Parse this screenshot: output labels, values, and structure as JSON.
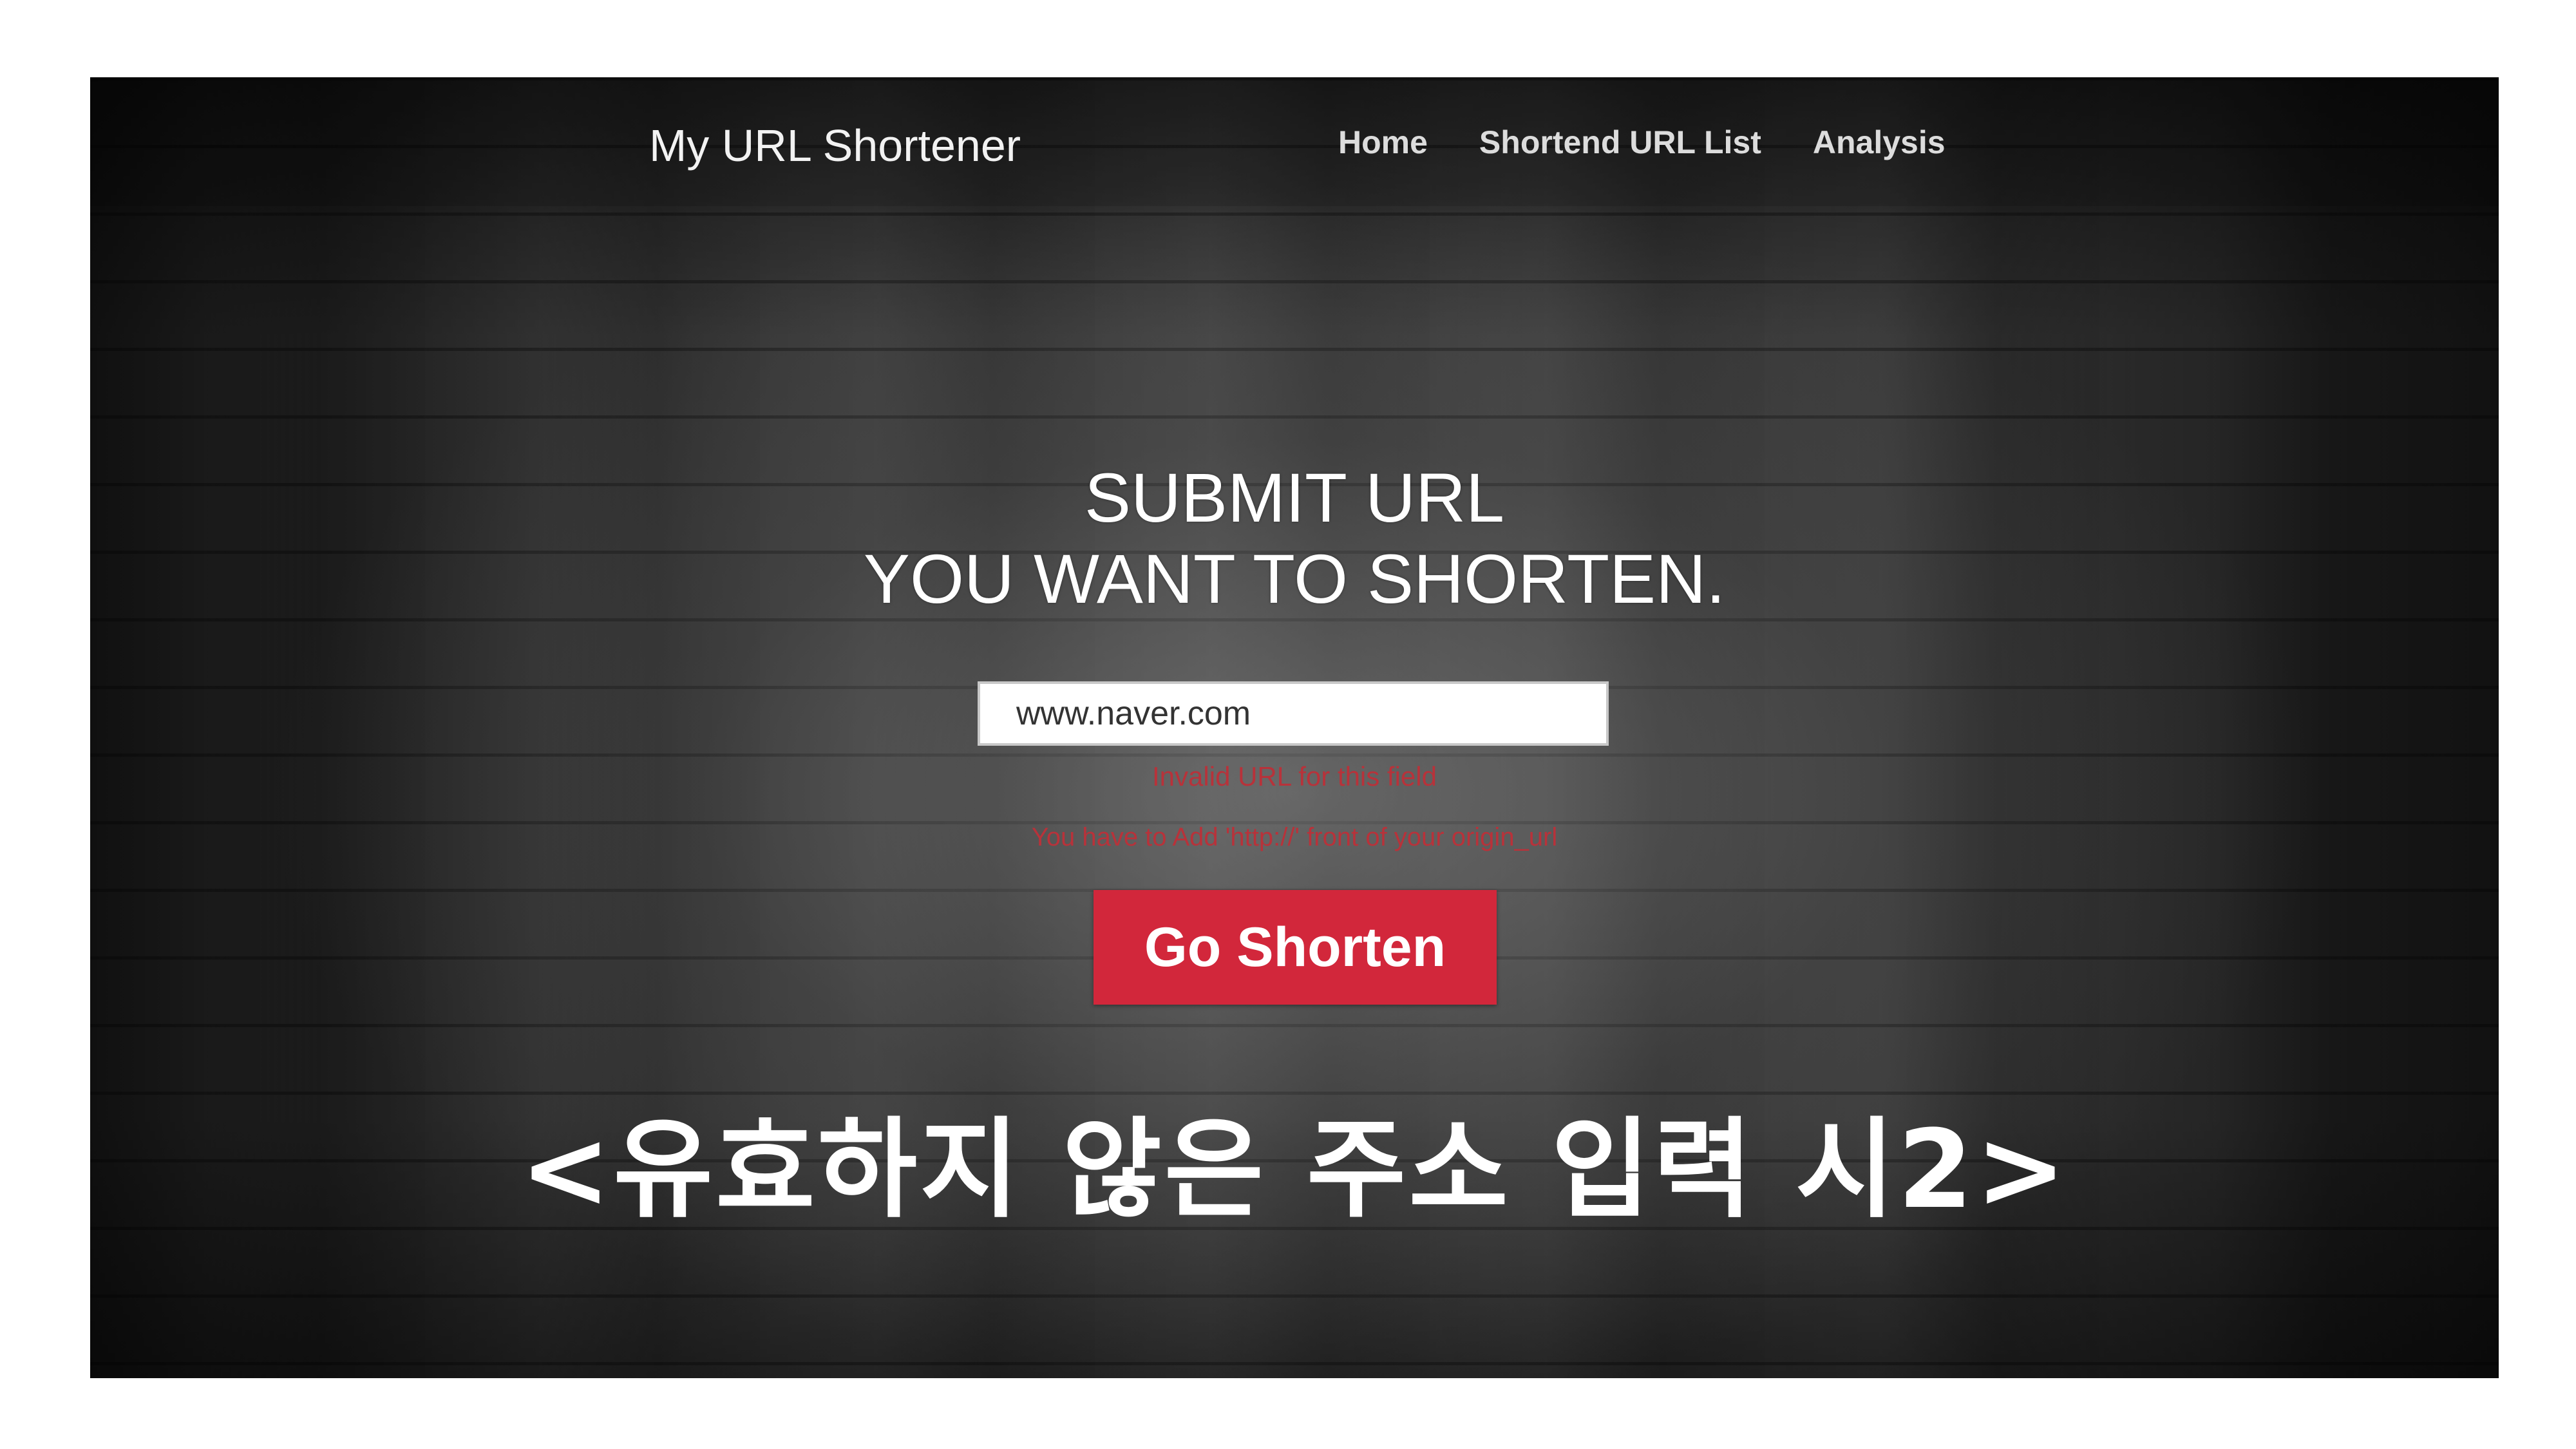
{
  "navbar": {
    "brand": "My URL Shortener",
    "links": [
      "Home",
      "Shortend URL List",
      "Analysis"
    ]
  },
  "hero": {
    "title_line1": "SUBMIT URL",
    "title_line2": "YOU WANT TO SHORTEN."
  },
  "form": {
    "url_value": "www.naver.com",
    "error_invalid": "Invalid URL for this field",
    "error_hint": "You have to Add 'http://' front of your origin_url",
    "submit_label": "Go Shorten"
  },
  "caption": "<유효하지 않은 주소 입력 시2>",
  "colors": {
    "button": "#d2273b",
    "error_text": "#b8323a",
    "background": "#3a3a3a"
  }
}
